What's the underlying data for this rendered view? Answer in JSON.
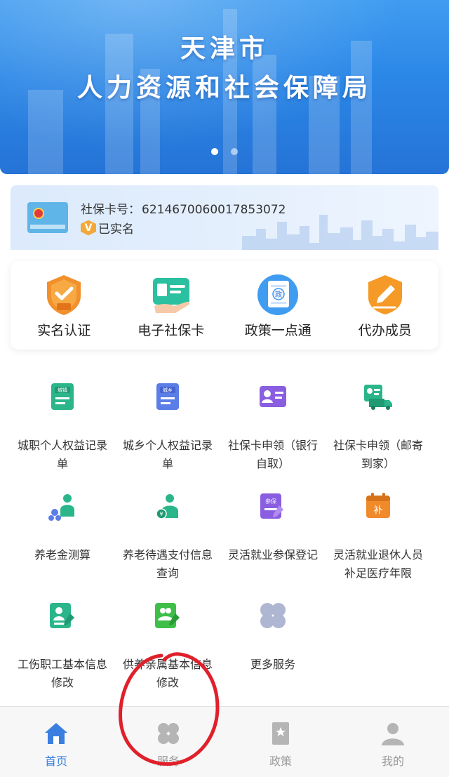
{
  "banner": {
    "title_line1": "天津市",
    "title_line2": "人力资源和社会保障局",
    "slides": 2,
    "active_slide": 1
  },
  "card": {
    "icon": "social-security-card-icon",
    "number_label": "社保卡号：",
    "number": "6214670060017853072",
    "badge": "V",
    "verified_text": "已实名"
  },
  "quick_menu": [
    {
      "label": "实名认证",
      "icon": "verify-shield-icon"
    },
    {
      "label": "电子社保卡",
      "icon": "e-card-icon"
    },
    {
      "label": "政策一点通",
      "icon": "policy-doc-icon"
    },
    {
      "label": "代办成员",
      "icon": "proxy-pen-icon"
    }
  ],
  "services": [
    {
      "label": "城职个人权益记录单",
      "icon": "urban-record-icon",
      "icon_text": "城镇"
    },
    {
      "label": "城乡个人权益记录单",
      "icon": "rural-record-icon",
      "icon_text": "城乡"
    },
    {
      "label": "社保卡申领（银行自取）",
      "icon": "card-apply-bank-icon",
      "icon_text": ""
    },
    {
      "label": "社保卡申领（邮寄到家）",
      "icon": "card-apply-mail-icon",
      "icon_text": ""
    },
    {
      "label": "养老金测算",
      "icon": "pension-calc-icon",
      "icon_text": ""
    },
    {
      "label": "养老待遇支付信息查询",
      "icon": "pension-payment-icon",
      "icon_text": ""
    },
    {
      "label": "灵活就业参保登记",
      "icon": "flexible-enroll-icon",
      "icon_text": "参保"
    },
    {
      "label": "灵活就业退休人员补足医疗年限",
      "icon": "retiree-supplement-icon",
      "icon_text": "补"
    },
    {
      "label": "工伤职工基本信息修改",
      "icon": "injury-edit-icon",
      "icon_text": ""
    },
    {
      "label": "供养亲属基本信息修改",
      "icon": "dependent-edit-icon",
      "icon_text": ""
    },
    {
      "label": "更多服务",
      "icon": "more-services-icon",
      "icon_text": ""
    }
  ],
  "tabs": [
    {
      "label": "首页",
      "icon": "home-icon",
      "active": true
    },
    {
      "label": "服务",
      "icon": "services-icon",
      "active": false
    },
    {
      "label": "政策",
      "icon": "policy-icon",
      "active": false
    },
    {
      "label": "我的",
      "icon": "profile-icon",
      "active": false
    }
  ],
  "colors": {
    "banner": "#2b87e6",
    "accent": "#3a7fe0",
    "service_green": "#2bb58a",
    "service_blue": "#5b7de8",
    "service_purple": "#8a5ee0",
    "service_orange": "#f08a2a",
    "annotation_red": "#e0202a"
  }
}
